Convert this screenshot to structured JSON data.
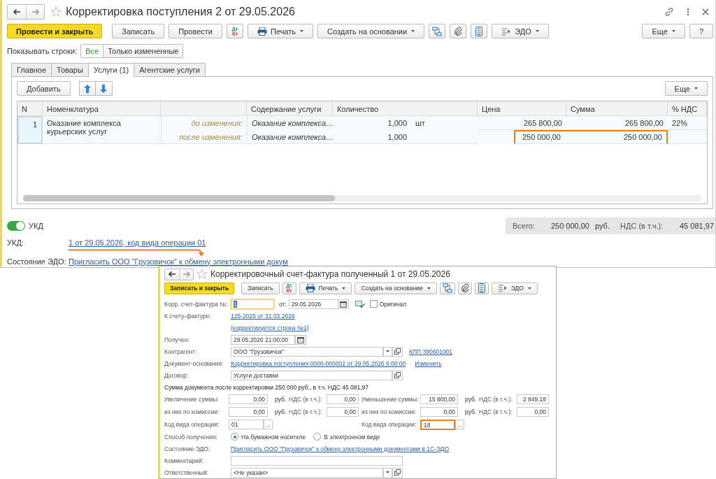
{
  "window": {
    "title": "Корректировка поступления 2 от 29.05.2026"
  },
  "toolbar": [
    {
      "kind": "primary",
      "label": "Провести и закрыть"
    },
    {
      "kind": "button",
      "label": "Записать"
    },
    {
      "kind": "button",
      "label": "Провести"
    },
    {
      "kind": "dtkt",
      "top": "Дт",
      "bottom": "Кт"
    },
    {
      "kind": "print",
      "label": "Печать"
    },
    {
      "kind": "menu",
      "label": "Создать на основании"
    },
    {
      "kind": "structure"
    },
    {
      "kind": "attach"
    },
    {
      "kind": "calc"
    },
    {
      "kind": "edo",
      "label": "ЭДО"
    }
  ],
  "toolbar_right": [
    {
      "kind": "menu",
      "label": "Еще"
    },
    {
      "kind": "button",
      "label": "?"
    }
  ],
  "show_rows": {
    "label": "Показывать строки:",
    "options": [
      {
        "label": "Все",
        "selected": true
      },
      {
        "label": "Только измененные",
        "selected": false
      }
    ]
  },
  "tabs": [
    {
      "label": "Главное",
      "selected": false
    },
    {
      "label": "Товары",
      "selected": false
    },
    {
      "label": "Услуги (1)",
      "selected": true
    },
    {
      "label": "Агентские услуги",
      "selected": false
    }
  ],
  "table_toolbar": {
    "add": "Добавить",
    "more": "Еще"
  },
  "table": {
    "columns": [
      {
        "kind": "text",
        "label": "N"
      },
      {
        "kind": "text",
        "label": "Номенклатура"
      },
      {
        "kind": "blank"
      },
      {
        "kind": "text",
        "label": "Содержание услуги"
      },
      {
        "kind": "double",
        "label": "Количество"
      },
      {
        "kind": "text",
        "label": "Цена"
      },
      {
        "kind": "text",
        "label": "Сумма"
      },
      {
        "kind": "text",
        "label": "% НДС"
      }
    ],
    "rows": [
      {
        "n": "1",
        "name": "Оказание комплекса курьерских услуг",
        "selected": true,
        "lines": [
          {
            "stage": "до изменения:",
            "content": "Оказание комплекса…",
            "qty": "1,000",
            "unit": "шт",
            "price": "265 800,00",
            "sum": "265 800,00",
            "vat": "22%",
            "highlighted": false
          },
          {
            "stage": "после изменения:",
            "content": "Оказание комплекса…",
            "qty": "1,000",
            "price": "250 000,00",
            "sum": "250 000,00",
            "highlighted": true
          }
        ]
      }
    ]
  },
  "ukd_toggle": {
    "label": "УКД",
    "on": true
  },
  "totals": {
    "total_label": "Всего:",
    "total": "250 000,00",
    "currency": "руб.",
    "vat_label": "НДС (в т.ч.):",
    "vat": "45 081,97"
  },
  "ukd": {
    "label": "УКД:",
    "link": "1 от 29.05.2026, код вида операции 01",
    "annotated": true
  },
  "edo": {
    "label": "Состояние ЭДО:",
    "link": "Пригласить ООО \"Грузовичок\" к обмену электронными докум"
  },
  "invoice_window": {
    "title": "Корректировочный счет-фактура полученный 1 от 29.05.2026",
    "toolbar": [
      {
        "kind": "primary",
        "label": "Записать и закрыть"
      },
      {
        "kind": "button",
        "label": "Записать"
      },
      {
        "kind": "dtkt",
        "top": "Дт",
        "bottom": "Кт"
      },
      {
        "kind": "print",
        "label": "Печать"
      },
      {
        "kind": "menu",
        "label": "Создать на основании"
      },
      {
        "kind": "structure"
      },
      {
        "kind": "attach"
      },
      {
        "kind": "calc"
      },
      {
        "kind": "edo",
        "label": "ЭДО"
      }
    ],
    "number": {
      "label": "Корр. счет-фактура №:",
      "value": "1",
      "focused": true
    },
    "date": {
      "label": "от:",
      "value": "29.05.2026"
    },
    "original": {
      "label": "Оригинал",
      "checked": false
    },
    "base_invoice": {
      "label": "К счету-фактуре:",
      "link": "125-2026 от 31.03.2026",
      "note_link": "(корректируется строка №1)"
    },
    "received": {
      "label": "Получен:",
      "value": "29.05.2026 21:00:00"
    },
    "counterparty": {
      "label": "Контрагент:",
      "value": "ООО \"Грузовичок\"",
      "kpp_link": "КПП 390601001"
    },
    "base_document": {
      "label": "Документ-основания:",
      "link": "Корректировка поступления 0000-000002 от 29.05.2026 9:00:00",
      "change_link": "Изменить"
    },
    "contract": {
      "label": "Договор:",
      "value": "Услуги доставки"
    },
    "summary": "Сумма документа после корректировки 250 000 руб., в т.ч. НДС 45 081,97",
    "amount_rows": [
      {
        "left": {
          "label": "Увеличение суммы:",
          "value": "0,00",
          "currency": "руб.",
          "vat_label": "НДС (в т.ч.):",
          "vat": "0,00"
        },
        "right": {
          "label": "Уменьшение суммы:",
          "value": "15 800,00",
          "currency": "руб.",
          "vat_label": "НДС (в т.ч.):",
          "vat": "2 849,18"
        }
      },
      {
        "left": {
          "label": "из них по комиссии:",
          "value": "0,00",
          "currency": "руб.",
          "vat_label": "НДС (в т.ч.):",
          "vat": "0,00"
        },
        "right": {
          "label": "из них по комиссии:",
          "value": "0,00",
          "currency": "руб.",
          "vat_label": "НДС (в т.ч.):",
          "vat": "0,00"
        }
      }
    ],
    "operation_codes": [
      {
        "label": "Код вида операции:",
        "value": "01",
        "choose": "...",
        "highlighted": false
      },
      {
        "label": "Код вида операции:",
        "value": "18",
        "choose": "...",
        "highlighted": true
      }
    ],
    "receipt": {
      "label": "Способ получения:",
      "options": [
        {
          "label": "На бумажном носителе",
          "selected": true
        },
        {
          "label": "В электронном виде",
          "selected": false
        }
      ]
    },
    "edo": {
      "label": "Состояние ЭДО:",
      "link": "Пригласить ООО \"Грузовичок\" к обмену электронными документами в 1С-ЭДО"
    },
    "comment": {
      "label": "Комментарий:"
    },
    "responsible": {
      "label": "Ответственный:",
      "value": "<Не указан>"
    }
  }
}
